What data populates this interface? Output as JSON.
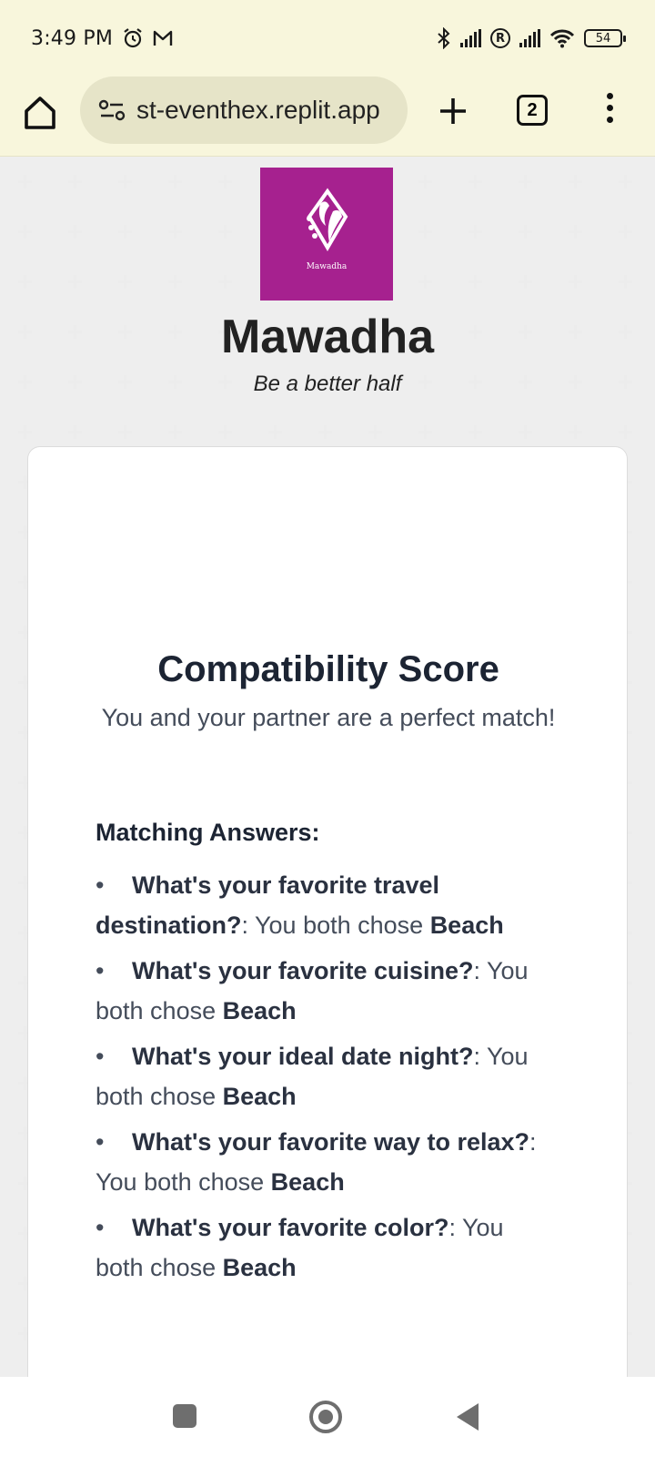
{
  "status_bar": {
    "time": "3:49 PM",
    "left_icons": [
      "alarm-icon",
      "gmail-icon"
    ],
    "right_icons": [
      "bluetooth-icon",
      "signal-icon",
      "roaming-icon",
      "signal-icon",
      "wifi-icon"
    ],
    "roaming_label": "R",
    "battery": "54"
  },
  "browser": {
    "url": "st-eventhex.replit.app",
    "tab_count": "2"
  },
  "brand": {
    "logo_text": "Mawadha",
    "logo_color": "#a6218f",
    "title": "Mawadha",
    "tagline": "Be a better half"
  },
  "result": {
    "title": "Compatibility Score",
    "subtitle": "You and your partner are a perfect match!",
    "answers_heading": "Matching Answers:",
    "answers": [
      {
        "question": "What's your favorite travel destination?",
        "sep": ": You both chose ",
        "answer": "Beach"
      },
      {
        "question": "What's your favorite cuisine?",
        "sep": ": You both chose ",
        "answer": "Beach"
      },
      {
        "question": "What's your ideal date night?",
        "sep": ": You both chose ",
        "answer": "Beach"
      },
      {
        "question": "What's your favorite way to relax?",
        "sep": ": You both chose ",
        "answer": "Beach"
      },
      {
        "question": "What's your favorite color?",
        "sep": ": You both chose ",
        "answer": "Beach"
      }
    ]
  },
  "nav": {
    "buttons": [
      "recents-icon",
      "home-icon",
      "back-icon"
    ]
  }
}
